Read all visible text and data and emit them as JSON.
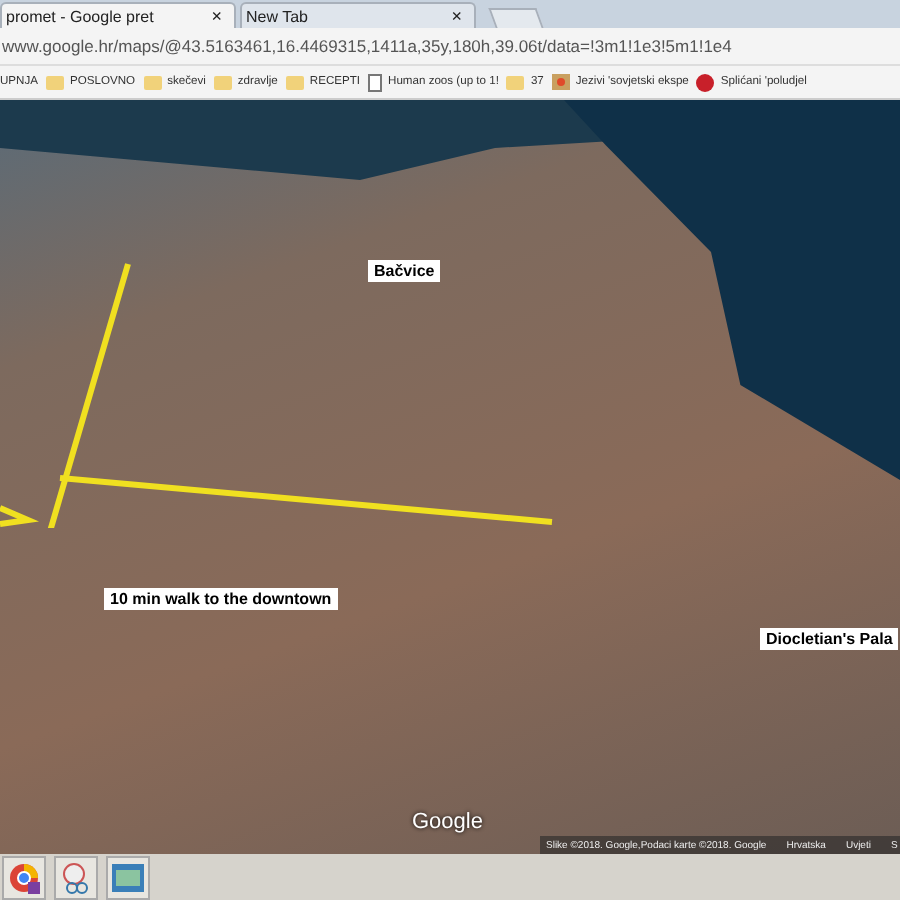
{
  "tabs": [
    {
      "title": "promet - Google pret",
      "close": "×",
      "selected": true
    },
    {
      "title": "New Tab",
      "close": "×",
      "selected": false
    }
  ],
  "address": "www.google.hr/maps/@43.5163461,16.4469315,1411a,35y,180h,39.06t/data=!3m1!1e3!5m1!1e4",
  "bookmarks": [
    {
      "label": "UPNJA",
      "kind": "none"
    },
    {
      "label": "POSLOVNO",
      "kind": "folder"
    },
    {
      "label": "skečevi",
      "kind": "folder"
    },
    {
      "label": "zdravlje",
      "kind": "folder"
    },
    {
      "label": "RECEPTI",
      "kind": "folder"
    },
    {
      "label": "Human zoos (up to 1!",
      "kind": "page"
    },
    {
      "label": "37",
      "kind": "folder"
    },
    {
      "label": "Jezivi 'sovjetski ekspe",
      "kind": "image"
    },
    {
      "label": "Splićani 'poludjel",
      "kind": "badge"
    }
  ],
  "map": {
    "labels": [
      {
        "text": "Bačvice",
        "kind": "place"
      },
      {
        "text": "10 min walk to the downtown",
        "kind": "route"
      },
      {
        "text": "Diocletian's Pala",
        "kind": "edge"
      }
    ],
    "logo": "Google",
    "footer": [
      "Slike ©2018. Google,Podaci karte ©2018. Google",
      "Hrvatska",
      "Uvjeti",
      "S"
    ]
  },
  "taskbar": [
    {
      "kind": "browser"
    },
    {
      "kind": "tool"
    },
    {
      "kind": "photos"
    }
  ]
}
